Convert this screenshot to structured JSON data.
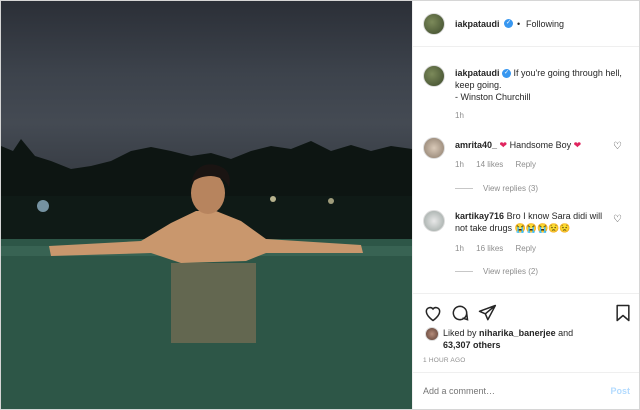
{
  "post": {
    "username": "iakpataudi",
    "following": "Following",
    "caption_user": "iakpataudi",
    "caption_text": "If you're going through hell, keep going.",
    "caption_attr": "- Winston Churchill",
    "caption_time": "1h"
  },
  "comments": [
    {
      "user": "amrita40_",
      "text": "Handsome Boy",
      "time": "1h",
      "likes": "14 likes",
      "reply": "Reply",
      "view": "View replies (3)"
    },
    {
      "user": "kartikay716",
      "text": "Bro I know Sara didi will not take drugs",
      "time": "1h",
      "likes": "16 likes",
      "reply": "Reply",
      "view": "View replies (2)"
    }
  ],
  "likes": {
    "prefix": "Liked by",
    "user": "niharika_banerjee",
    "and": "and",
    "count": "63,307 others"
  },
  "timestamp": "1 HOUR AGO",
  "comment_box": {
    "placeholder": "Add a comment…",
    "post": "Post"
  },
  "icons": [
    "heart-icon",
    "comment-icon",
    "share-icon",
    "bookmark-icon",
    "verified-icon",
    "heart-emoji-icon"
  ],
  "colors": {
    "verified": "#3897f0",
    "heart_emoji": "#e0245e"
  }
}
